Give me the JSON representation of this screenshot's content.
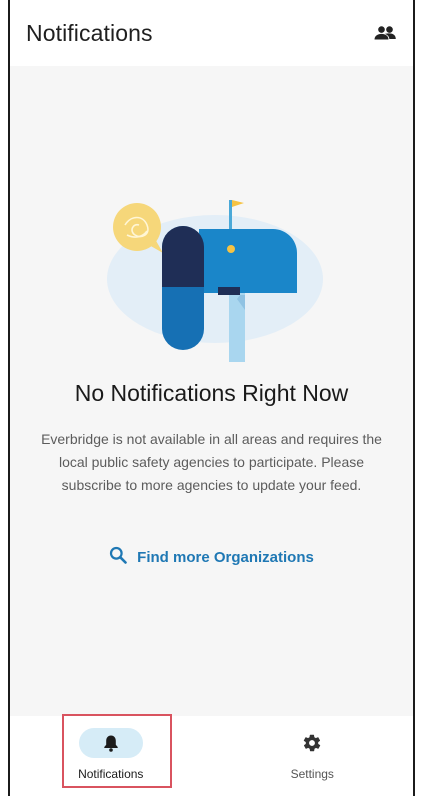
{
  "app_bar": {
    "title": "Notifications",
    "action_icon": "people-icon"
  },
  "empty_state": {
    "title": "No Notifications Right Now",
    "description": "Everbridge is not available in all areas and requires the local public safety agencies to participate. Please subscribe to more agencies to update your feed.",
    "link_label": "Find more Organizations",
    "link_icon": "search-icon"
  },
  "bottom_nav": {
    "items": [
      {
        "label": "Notifications",
        "icon": "bell-icon",
        "active": true
      },
      {
        "label": "Settings",
        "icon": "gear-icon",
        "active": false
      }
    ]
  },
  "colors": {
    "accent": "#1f78b4",
    "nav_active_pill": "#d6ecf7",
    "highlight": "#d9535f"
  }
}
